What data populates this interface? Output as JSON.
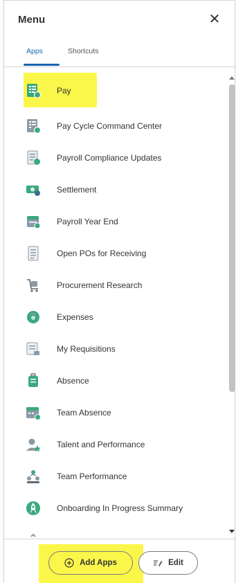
{
  "header": {
    "title": "Menu",
    "close_label": "✕"
  },
  "tabs": [
    {
      "label": "Apps",
      "active": true
    },
    {
      "label": "Shortcuts",
      "active": false
    }
  ],
  "apps": [
    {
      "label": "Pay",
      "icon": "pay-icon",
      "highlighted": true
    },
    {
      "label": "Pay Cycle Command Center",
      "icon": "pay-cycle-icon"
    },
    {
      "label": "Payroll Compliance Updates",
      "icon": "payroll-compliance-icon"
    },
    {
      "label": "Settlement",
      "icon": "settlement-icon"
    },
    {
      "label": "Payroll Year End",
      "icon": "payroll-year-end-icon"
    },
    {
      "label": "Open POs for Receiving",
      "icon": "document-icon"
    },
    {
      "label": "Procurement Research",
      "icon": "procurement-icon"
    },
    {
      "label": "Expenses",
      "icon": "expenses-icon"
    },
    {
      "label": "My Requisitions",
      "icon": "requisitions-icon"
    },
    {
      "label": "Absence",
      "icon": "luggage-icon"
    },
    {
      "label": "Team Absence",
      "icon": "calendar-icon"
    },
    {
      "label": "Talent and Performance",
      "icon": "talent-icon"
    },
    {
      "label": "Team Performance",
      "icon": "team-icon"
    },
    {
      "label": "Onboarding In Progress Summary",
      "icon": "rocket-icon"
    }
  ],
  "footer": {
    "add_apps_label": "Add Apps",
    "edit_label": "Edit"
  },
  "colors": {
    "accent": "#1a66b3",
    "highlight": "#fbf64a",
    "icon_green": "#3aa97e",
    "icon_gray": "#8c9aa6"
  }
}
